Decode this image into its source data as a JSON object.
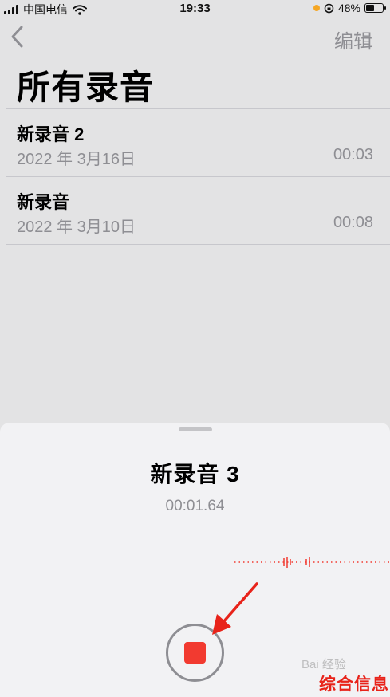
{
  "status_bar": {
    "carrier": "中国电信",
    "time": "19:33",
    "battery": "48%",
    "battery_level": 0.48
  },
  "nav": {
    "back_icon": "chevron-left-icon",
    "edit_label": "编辑"
  },
  "page_title": "所有录音",
  "recordings": [
    {
      "title": "新录音 2",
      "date": "2022 年 3月16日",
      "duration": "00:03"
    },
    {
      "title": "新录音",
      "date": "2022 年 3月10日",
      "duration": "00:08"
    }
  ],
  "recorder": {
    "title": "新录音 3",
    "elapsed": "00:01.64"
  },
  "watermark": {
    "faint": "Bai 经验",
    "brand": "综合信息"
  },
  "colors": {
    "record_red": "#f23a30",
    "annotation_arrow": "#e8231a",
    "secondary_text": "#8e8e93"
  }
}
